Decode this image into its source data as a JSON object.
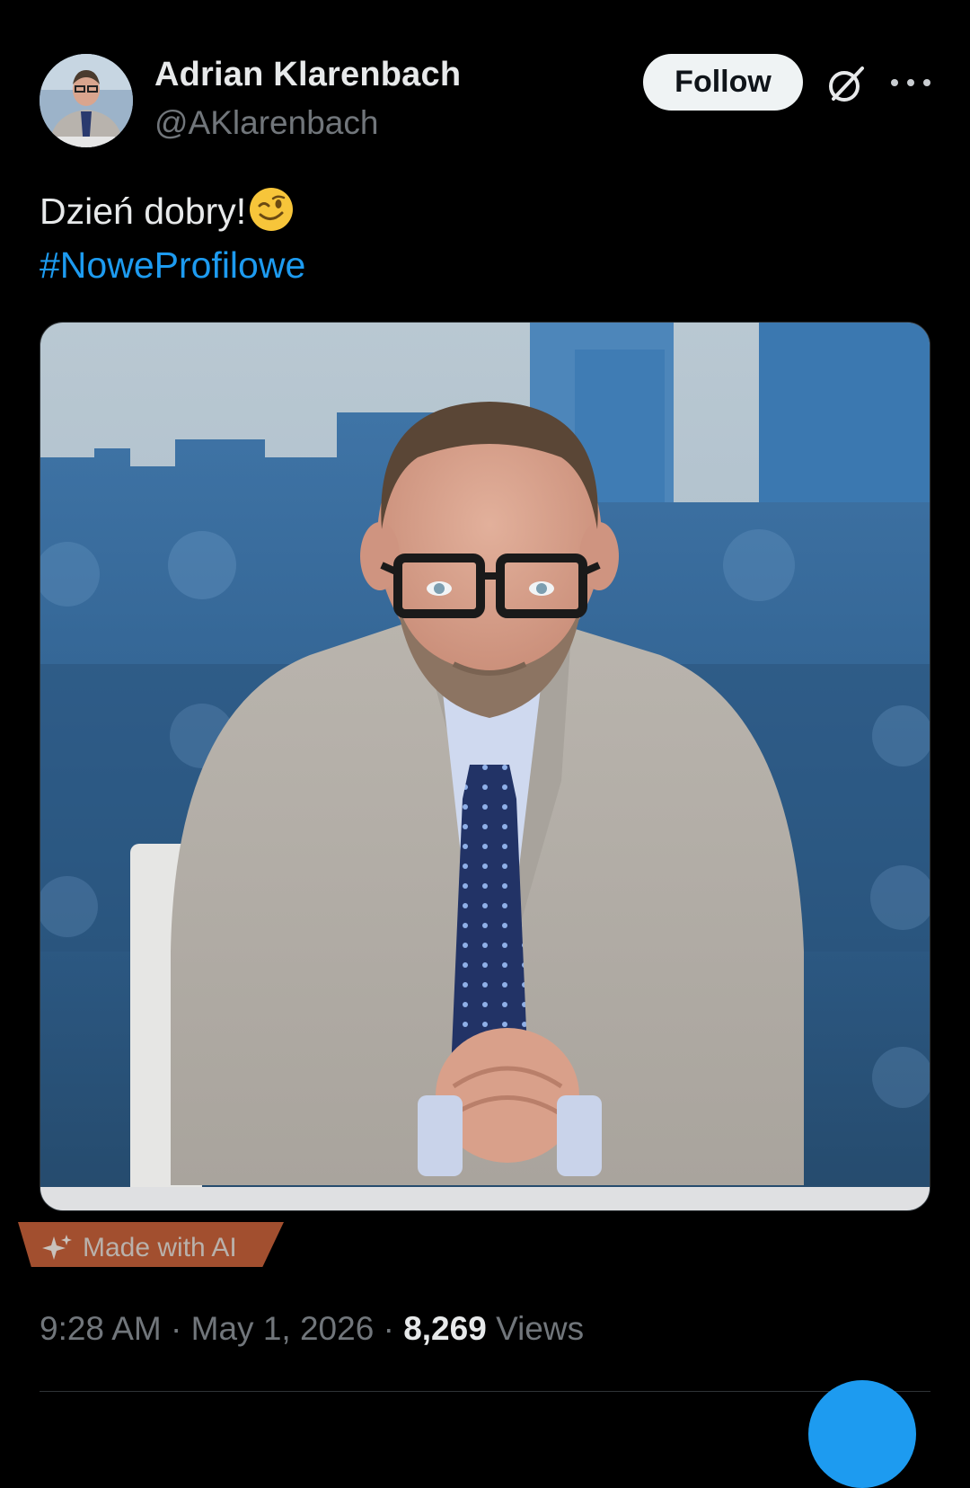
{
  "author": {
    "display_name": "Adrian Klarenbach",
    "handle": "@AKlarenbach",
    "follow_label": "Follow"
  },
  "icons": {
    "grok": "grok-icon",
    "more": "more-icon",
    "emoji": "winking-face-emoji",
    "ai_sparkle": "sparkle-icon"
  },
  "tweet": {
    "text": "Dzień dobry!",
    "hashtag": "#NoweProfilowe",
    "media_label": "Made with AI"
  },
  "meta": {
    "time": "9:28 AM",
    "separator": "·",
    "date": "May 1, 2026",
    "views_count": "8,269",
    "views_label": "Views"
  },
  "colors": {
    "background": "#000000",
    "text_primary": "#e7e9ea",
    "text_secondary": "#71767b",
    "link": "#1d9bf0",
    "ai_label_bg": "#b85a36"
  }
}
